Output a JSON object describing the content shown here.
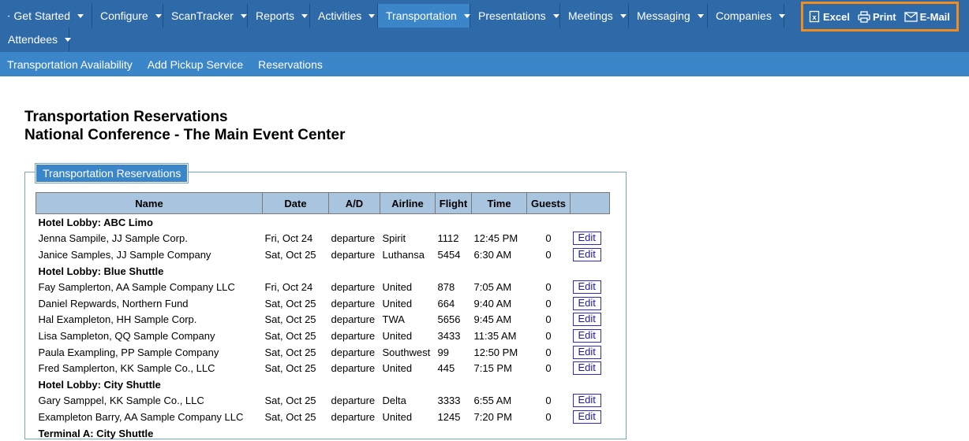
{
  "nav": {
    "row1": [
      {
        "label": "Get Started",
        "icon": "home-icon",
        "width": 117
      },
      {
        "label": "Configure",
        "width": 90
      },
      {
        "label": "ScanTracker",
        "width": 107
      },
      {
        "label": "Reports",
        "width": 79
      },
      {
        "label": "Activities",
        "width": 86
      },
      {
        "label": "Transportation",
        "width": 117,
        "active": true
      },
      {
        "label": "Presentations",
        "width": 114
      },
      {
        "label": "Meetings",
        "width": 87
      },
      {
        "label": "Messaging",
        "width": 100
      },
      {
        "label": "Companies",
        "width": 97
      }
    ],
    "row2": [
      {
        "label": "Attendees",
        "width": 88
      }
    ]
  },
  "tools": {
    "excel": "Excel",
    "print": "Print",
    "email": "E-Mail"
  },
  "subnav": [
    "Transportation Availability",
    "Add Pickup Service",
    "Reservations"
  ],
  "page": {
    "title1": "Transportation Reservations",
    "title2": "National Conference - The Main Event Center",
    "legend": "Transportation Reservations"
  },
  "table": {
    "headers": [
      "Name",
      "Date",
      "A/D",
      "Airline",
      "Flight",
      "Time",
      "Guests",
      ""
    ],
    "rows": [
      {
        "group": "Hotel Lobby: ABC Limo"
      },
      {
        "name": "Jenna Sampile, JJ Sample Corp.",
        "date": "Fri, Oct 24",
        "ad": "departure",
        "airline": "Spirit",
        "flight": "1112",
        "time": "12:45 PM",
        "guests": "0",
        "edit": "Edit"
      },
      {
        "name": "Janice Samples, JJ Sample Company",
        "date": "Sat, Oct 25",
        "ad": "departure",
        "airline": "Luthansa",
        "flight": "5454",
        "time": "6:30 AM",
        "guests": "0",
        "edit": "Edit"
      },
      {
        "group": "Hotel Lobby: Blue Shuttle"
      },
      {
        "name": "Fay Samplerton, AA Sample Company LLC",
        "date": "Fri, Oct 24",
        "ad": "departure",
        "airline": "United",
        "flight": "878",
        "time": "7:05 AM",
        "guests": "0",
        "edit": "Edit"
      },
      {
        "name": "Daniel Repwards, Northern Fund",
        "date": "Sat, Oct 25",
        "ad": "departure",
        "airline": "United",
        "flight": "664",
        "time": "9:40 AM",
        "guests": "0",
        "edit": "Edit"
      },
      {
        "name": "Hal Exampleton, HH Sample Corp.",
        "date": "Sat, Oct 25",
        "ad": "departure",
        "airline": "TWA",
        "flight": "5656",
        "time": "9:45 AM",
        "guests": "0",
        "edit": "Edit"
      },
      {
        "name": "Lisa Sampleton, QQ Sample Company",
        "date": "Sat, Oct 25",
        "ad": "departure",
        "airline": "United",
        "flight": "3433",
        "time": "11:35 AM",
        "guests": "0",
        "edit": "Edit"
      },
      {
        "name": "Paula Exampling, PP Sample Company",
        "date": "Sat, Oct 25",
        "ad": "departure",
        "airline": "Southwest",
        "flight": "99",
        "time": "12:50 PM",
        "guests": "0",
        "edit": "Edit"
      },
      {
        "name": "Fred Samplerton, KK Sample Co., LLC",
        "date": "Sat, Oct 25",
        "ad": "departure",
        "airline": "United",
        "flight": "445",
        "time": "7:15 PM",
        "guests": "0",
        "edit": "Edit"
      },
      {
        "group": "Hotel Lobby: City Shuttle"
      },
      {
        "name": "Gary Samppel, KK Sample Co., LLC",
        "date": "Sat, Oct 25",
        "ad": "departure",
        "airline": "Delta",
        "flight": "3333",
        "time": "6:55 AM",
        "guests": "0",
        "edit": "Edit"
      },
      {
        "name": "Exampleton Barry, AA Sample Company LLC",
        "date": "Sat, Oct 25",
        "ad": "departure",
        "airline": "United",
        "flight": "1245",
        "time": "7:20 PM",
        "guests": "0",
        "edit": "Edit"
      },
      {
        "group": "Terminal A: City Shuttle"
      }
    ]
  },
  "colors": {
    "nav": "#2f6aa8",
    "active": "#3b86c8",
    "highlight": "#f28c1b",
    "header": "#a9c4df"
  }
}
